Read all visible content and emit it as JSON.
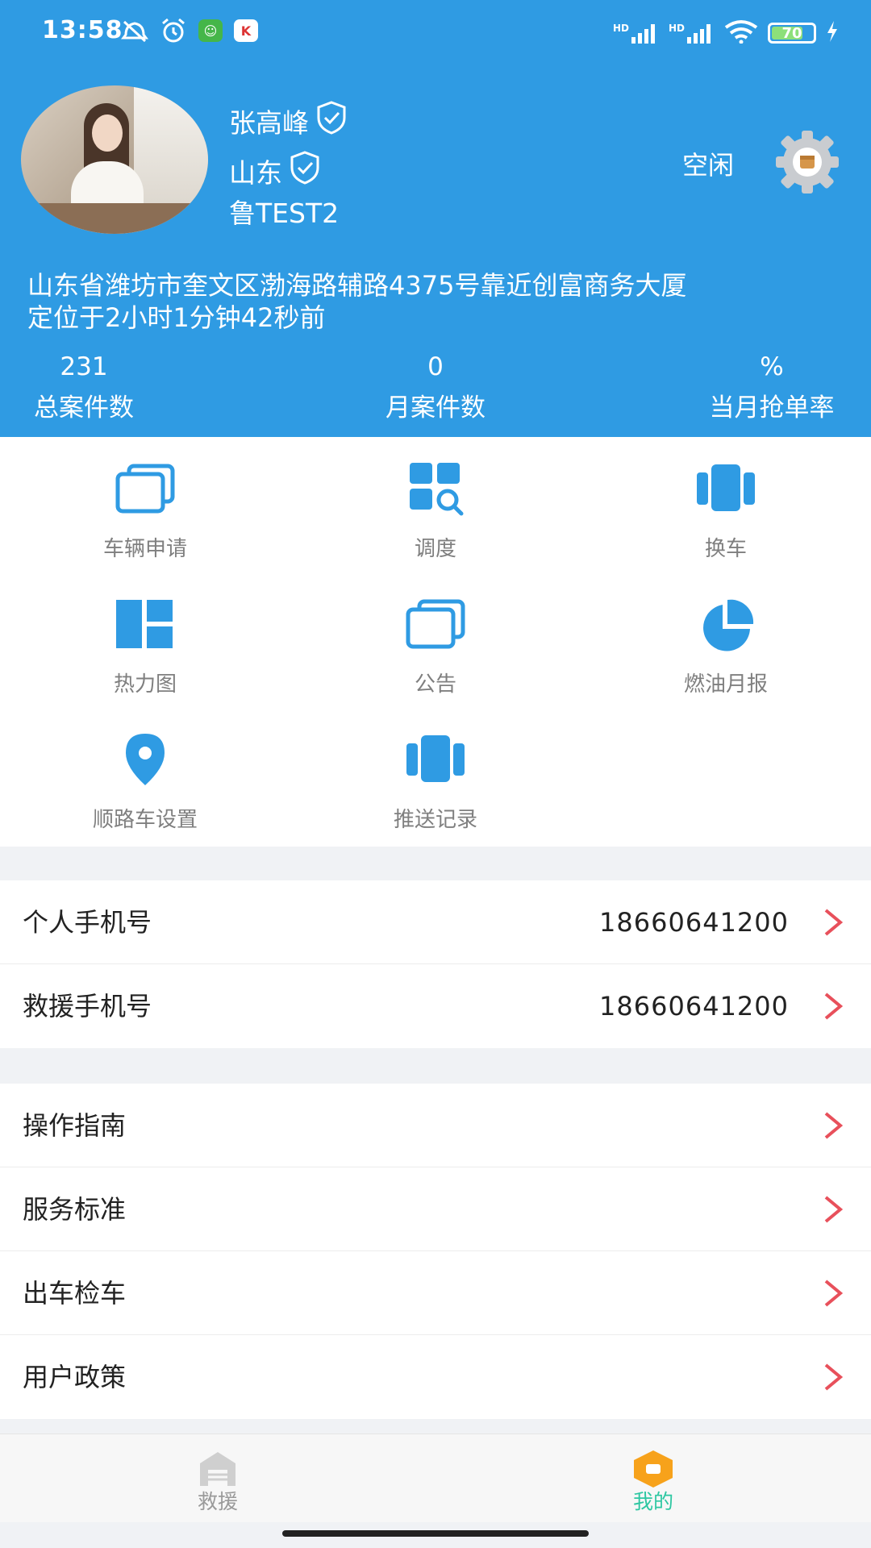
{
  "status_bar": {
    "time": "13:58",
    "battery": "70",
    "signal1": "HD",
    "signal2": "HD"
  },
  "profile": {
    "name": "张高峰",
    "province": "山东",
    "plate": "鲁TEST2",
    "status": "空闲",
    "address": "山东省潍坊市奎文区渤海路辅路4375号靠近创富商务大厦",
    "located": "定位于2小时1分钟42秒前"
  },
  "stats": [
    {
      "value": "231",
      "label": "总案件数"
    },
    {
      "value": "0",
      "label": "月案件数"
    },
    {
      "value": "%",
      "label": "当月抢单率"
    }
  ],
  "grid": [
    {
      "label": "车辆申请",
      "icon": "cards-icon"
    },
    {
      "label": "调度",
      "icon": "grid-search-icon"
    },
    {
      "label": "换车",
      "icon": "carousel-icon"
    },
    {
      "label": "热力图",
      "icon": "dashboard-icon"
    },
    {
      "label": "公告",
      "icon": "cards-icon"
    },
    {
      "label": "燃油月报",
      "icon": "pie-icon"
    },
    {
      "label": "顺路车设置",
      "icon": "location-pin-icon"
    },
    {
      "label": "推送记录",
      "icon": "carousel-icon"
    }
  ],
  "contacts": [
    {
      "label": "个人手机号",
      "value": "18660641200"
    },
    {
      "label": "救援手机号",
      "value": "18660641200"
    }
  ],
  "links": [
    {
      "label": "操作指南"
    },
    {
      "label": "服务标准"
    },
    {
      "label": "出车检车"
    },
    {
      "label": "用户政策"
    }
  ],
  "tabs": [
    {
      "label": "救援",
      "active": false
    },
    {
      "label": "我的",
      "active": true
    }
  ],
  "colors": {
    "brand": "#2f9be3",
    "icon": "#2f9be3",
    "chevron": "#e8505b",
    "tab_active": "#2ec7a2",
    "tab_active_icon": "#f7a21b"
  }
}
